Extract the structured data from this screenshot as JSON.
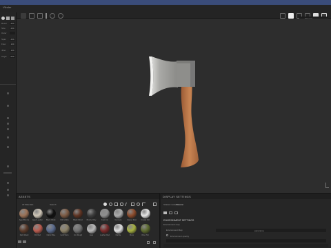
{
  "app": {
    "window_title": "Vlinder"
  },
  "header": {
    "shading_dropdown": "Material"
  },
  "left_panel": {
    "rows": [
      {
        "label": "Resol",
        "value": "200"
      },
      {
        "label": "Size",
        "value": "200"
      },
      {
        "label": "Outer",
        "value": ""
      },
      {
        "label": "Spac",
        "value": "200"
      },
      {
        "label": "Flow",
        "value": "100"
      },
      {
        "label": "Jitter",
        "value": "100"
      },
      {
        "label": "Angle",
        "value": "000"
      }
    ]
  },
  "assets": {
    "title": "ASSETS",
    "filter": "All Materials",
    "search_placeholder": "Search",
    "materials": [
      "Aged Bronze",
      "Aged Leather",
      "Black Obsid.",
      "Old Cobble",
      "Blank Wood",
      "Bronze Dirty",
      "Cast Iron",
      "Concrete",
      "Copper Rust",
      "Crystal Old",
      "Dark Wood",
      "Dirt Red",
      "Fabric Blue",
      "Gold Worn",
      "Iron Rough",
      "Jade",
      "Leather Red",
      "Marble",
      "Moss",
      "Olive Tint"
    ]
  },
  "display": {
    "title": "DISPLAY SETTINGS",
    "mode_label": "Shaded mode",
    "mode_value": "Material",
    "env_section": "ENVIRONMENT SETTINGS",
    "env_map_label": "Environment map",
    "env_map_caption": "Environment Map",
    "env_map_value": "panorama",
    "opacity_label": "Environment opacity"
  },
  "colors": {
    "accent": "#3a4c7a",
    "handle": "#b57448",
    "blade": "#9c9c98"
  }
}
